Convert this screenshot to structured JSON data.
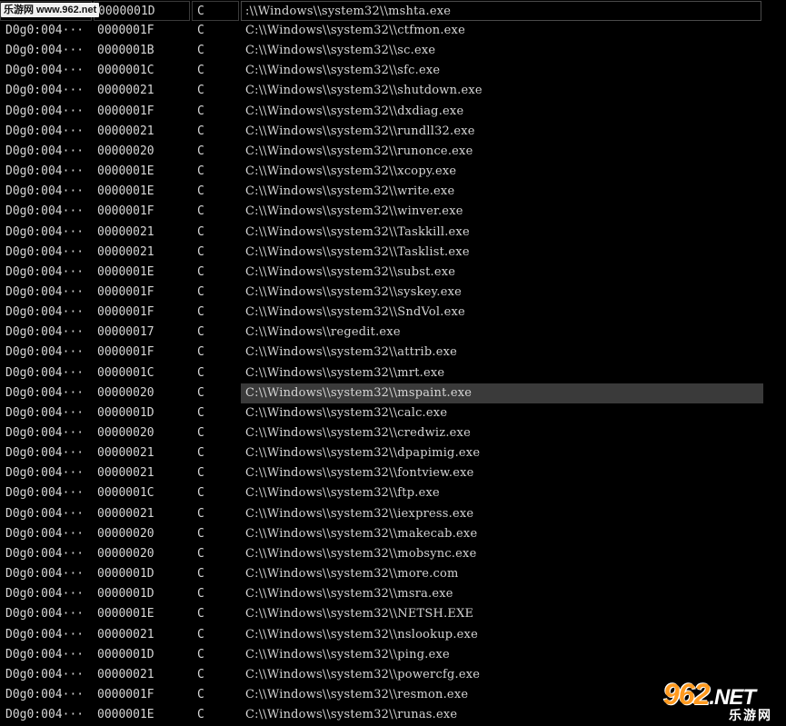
{
  "watermark_top": "乐游网 www.962.net",
  "header_row": {
    "length": "0000001D",
    "type": "C",
    "string": ":\\\\Windows\\\\system32\\\\mshta.exe"
  },
  "rows": [
    {
      "addr": "D0g0:004···",
      "length": "0000001F",
      "type": "C",
      "string": "C:\\\\Windows\\\\system32\\\\ctfmon.exe"
    },
    {
      "addr": "D0g0:004···",
      "length": "0000001B",
      "type": "C",
      "string": "C:\\\\Windows\\\\system32\\\\sc.exe"
    },
    {
      "addr": "D0g0:004···",
      "length": "0000001C",
      "type": "C",
      "string": "C:\\\\Windows\\\\system32\\\\sfc.exe"
    },
    {
      "addr": "D0g0:004···",
      "length": "00000021",
      "type": "C",
      "string": "C:\\\\Windows\\\\system32\\\\shutdown.exe"
    },
    {
      "addr": "D0g0:004···",
      "length": "0000001F",
      "type": "C",
      "string": "C:\\\\Windows\\\\system32\\\\dxdiag.exe"
    },
    {
      "addr": "D0g0:004···",
      "length": "00000021",
      "type": "C",
      "string": "C:\\\\Windows\\\\system32\\\\rundll32.exe"
    },
    {
      "addr": "D0g0:004···",
      "length": "00000020",
      "type": "C",
      "string": "C:\\\\Windows\\\\system32\\\\runonce.exe"
    },
    {
      "addr": "D0g0:004···",
      "length": "0000001E",
      "type": "C",
      "string": "C:\\\\Windows\\\\system32\\\\xcopy.exe"
    },
    {
      "addr": "D0g0:004···",
      "length": "0000001E",
      "type": "C",
      "string": "C:\\\\Windows\\\\system32\\\\write.exe"
    },
    {
      "addr": "D0g0:004···",
      "length": "0000001F",
      "type": "C",
      "string": "C:\\\\Windows\\\\system32\\\\winver.exe"
    },
    {
      "addr": "D0g0:004···",
      "length": "00000021",
      "type": "C",
      "string": "C:\\\\Windows\\\\system32\\\\Taskkill.exe"
    },
    {
      "addr": "D0g0:004···",
      "length": "00000021",
      "type": "C",
      "string": "C:\\\\Windows\\\\system32\\\\Tasklist.exe"
    },
    {
      "addr": "D0g0:004···",
      "length": "0000001E",
      "type": "C",
      "string": "C:\\\\Windows\\\\system32\\\\subst.exe"
    },
    {
      "addr": "D0g0:004···",
      "length": "0000001F",
      "type": "C",
      "string": "C:\\\\Windows\\\\system32\\\\syskey.exe"
    },
    {
      "addr": "D0g0:004···",
      "length": "0000001F",
      "type": "C",
      "string": "C:\\\\Windows\\\\system32\\\\SndVol.exe"
    },
    {
      "addr": "D0g0:004···",
      "length": "00000017",
      "type": "C",
      "string": "C:\\\\Windows\\\\regedit.exe"
    },
    {
      "addr": "D0g0:004···",
      "length": "0000001F",
      "type": "C",
      "string": "C:\\\\Windows\\\\system32\\\\attrib.exe"
    },
    {
      "addr": "D0g0:004···",
      "length": "0000001C",
      "type": "C",
      "string": "C:\\\\Windows\\\\system32\\\\mrt.exe"
    },
    {
      "addr": "D0g0:004···",
      "length": "00000020",
      "type": "C",
      "string": "C:\\\\Windows\\\\system32\\\\mspaint.exe",
      "selected": true
    },
    {
      "addr": "D0g0:004···",
      "length": "0000001D",
      "type": "C",
      "string": "C:\\\\Windows\\\\system32\\\\calc.exe"
    },
    {
      "addr": "D0g0:004···",
      "length": "00000020",
      "type": "C",
      "string": "C:\\\\Windows\\\\system32\\\\credwiz.exe"
    },
    {
      "addr": "D0g0:004···",
      "length": "00000021",
      "type": "C",
      "string": "C:\\\\Windows\\\\system32\\\\dpapimig.exe"
    },
    {
      "addr": "D0g0:004···",
      "length": "00000021",
      "type": "C",
      "string": "C:\\\\Windows\\\\system32\\\\fontview.exe"
    },
    {
      "addr": "D0g0:004···",
      "length": "0000001C",
      "type": "C",
      "string": "C:\\\\Windows\\\\system32\\\\ftp.exe"
    },
    {
      "addr": "D0g0:004···",
      "length": "00000021",
      "type": "C",
      "string": "C:\\\\Windows\\\\system32\\\\iexpress.exe"
    },
    {
      "addr": "D0g0:004···",
      "length": "00000020",
      "type": "C",
      "string": "C:\\\\Windows\\\\system32\\\\makecab.exe"
    },
    {
      "addr": "D0g0:004···",
      "length": "00000020",
      "type": "C",
      "string": "C:\\\\Windows\\\\system32\\\\mobsync.exe"
    },
    {
      "addr": "D0g0:004···",
      "length": "0000001D",
      "type": "C",
      "string": "C:\\\\Windows\\\\system32\\\\more.com"
    },
    {
      "addr": "D0g0:004···",
      "length": "0000001D",
      "type": "C",
      "string": "C:\\\\Windows\\\\system32\\\\msra.exe"
    },
    {
      "addr": "D0g0:004···",
      "length": "0000001E",
      "type": "C",
      "string": "C:\\\\Windows\\\\system32\\\\NETSH.EXE"
    },
    {
      "addr": "D0g0:004···",
      "length": "00000021",
      "type": "C",
      "string": "C:\\\\Windows\\\\system32\\\\nslookup.exe"
    },
    {
      "addr": "D0g0:004···",
      "length": "0000001D",
      "type": "C",
      "string": "C:\\\\Windows\\\\system32\\\\ping.exe"
    },
    {
      "addr": "D0g0:004···",
      "length": "00000021",
      "type": "C",
      "string": "C:\\\\Windows\\\\system32\\\\powercfg.exe"
    },
    {
      "addr": "D0g0:004···",
      "length": "0000001F",
      "type": "C",
      "string": "C:\\\\Windows\\\\system32\\\\resmon.exe"
    },
    {
      "addr": "D0g0:004···",
      "length": "0000001E",
      "type": "C",
      "string": "C:\\\\Windows\\\\system32\\\\runas.exe"
    }
  ],
  "logo": {
    "main": "962",
    "suffix": ".NET",
    "sub": "乐游网"
  },
  "colors": {
    "background": "#000000",
    "text": "#d6d6d6",
    "selected_row": "#3a3a3a",
    "logo_accent": "#ff9a1f"
  }
}
